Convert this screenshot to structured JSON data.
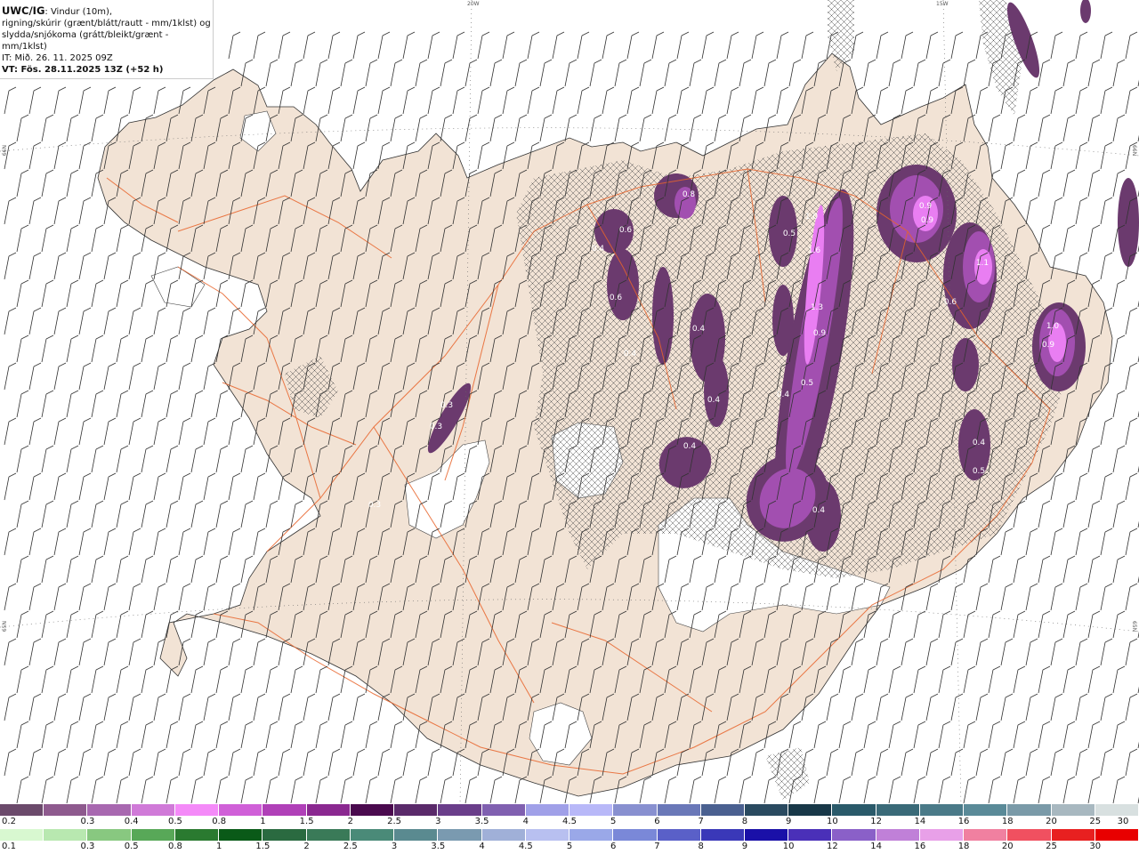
{
  "header": {
    "title": "UWC/IG",
    "desc_line1": ": Vindur (10m),",
    "desc_line2": "rigning/skúrir (grænt/blátt/rautt - mm/1klst) og",
    "desc_line3": "slydda/snjókoma (grátt/bleikt/grænt - mm/1klst)",
    "it": "IT: Mið. 26. 11. 2025 09Z",
    "vt": "VT: Fös. 28.11.2025 13Z (+52 h)"
  },
  "graticule": {
    "lon_top_1": "20W",
    "lon_top_2": "15W",
    "lat_left_1": "66N",
    "lat_left_2": "65N",
    "lat_right_1": "66N",
    "lat_right_2": "65N"
  },
  "colors": {
    "land": "#f2e3d5",
    "snow_free": "#ffffff",
    "roads": "#e8642b",
    "ocean": "#ffffff",
    "precip_dark": "#6b3a6e",
    "precip_mid": "#a24fb0",
    "precip_light": "#e97ef2"
  },
  "precip_labels": [
    "0.3",
    "0.3",
    "0.3",
    "0.4",
    "0.4",
    "0.4",
    "0.4",
    "0.4",
    "0.4",
    "0.4",
    "0.4",
    "0.5",
    "0.5",
    "0.5",
    "0.6",
    "0.6",
    "0.6",
    "0.8",
    "0.9",
    "0.9",
    "0.9",
    "0.9",
    "1.0",
    "1.0",
    "1.1",
    "1.3",
    "1.6"
  ],
  "legend_snow": {
    "ticks": [
      "0.2",
      "0.3",
      "0.4",
      "0.5",
      "0.8",
      "1",
      "1.5",
      "2",
      "2.5",
      "3",
      "3.5",
      "4",
      "4.5",
      "5",
      "6",
      "7",
      "8",
      "9",
      "10",
      "12",
      "14",
      "16",
      "18",
      "20",
      "25",
      "30"
    ],
    "colors": [
      "#6b4a6b",
      "#8e5a8e",
      "#a868b0",
      "#d07ad8",
      "#f48af8",
      "#d060d8",
      "#b040b8",
      "#8a2890",
      "#4a0a4e",
      "#5a2a6a",
      "#6a3e8a",
      "#8060b0",
      "#a0a0e8",
      "#b8b8f8",
      "#8890d0",
      "#6a78b8",
      "#4a6090",
      "#2a4a60",
      "#183848",
      "#2a5a6a",
      "#3a6a78",
      "#4a7a88",
      "#5a8a98",
      "#7a9aa8",
      "#a8b8c0",
      "#d8e0e0"
    ]
  },
  "legend_rain": {
    "ticks": [
      "0.1",
      "0.3",
      "0.5",
      "0.8",
      "1",
      "1.5",
      "2",
      "2.5",
      "3",
      "3.5",
      "4",
      "4.5",
      "5",
      "6",
      "7",
      "8",
      "9",
      "10",
      "12",
      "14",
      "16",
      "18",
      "20",
      "25",
      "30"
    ],
    "colors": [
      "#d8f8d0",
      "#b8e8b0",
      "#88c880",
      "#58a858",
      "#2a7a30",
      "#0a5a18",
      "#2a6a40",
      "#3a7a58",
      "#4a8a78",
      "#5a8a90",
      "#7a9ab0",
      "#a0b0d8",
      "#b8c0f0",
      "#9aa8e8",
      "#7a88d8",
      "#5a60c8",
      "#3a38b8",
      "#1a10a8",
      "#4a30b8",
      "#8a60c8",
      "#c080d8",
      "#e8a0e8",
      "#f080a0",
      "#f05060",
      "#e82020",
      "#e80000"
    ]
  }
}
